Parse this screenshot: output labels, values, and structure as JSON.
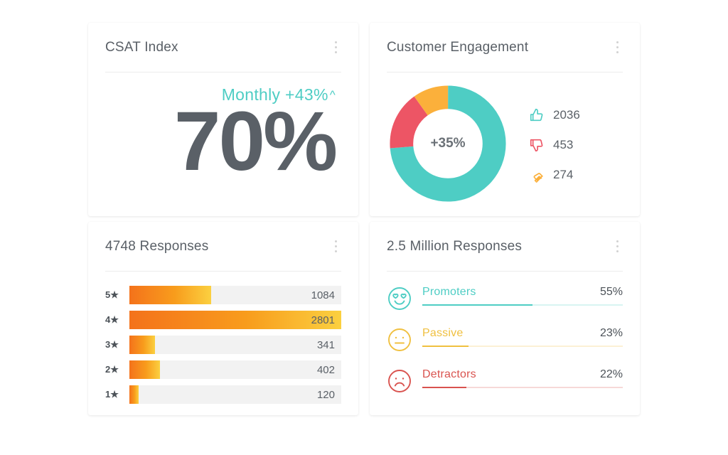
{
  "colors": {
    "teal": "#4ecdc4",
    "teal_dark": "#3fb8af",
    "red": "#ed5565",
    "yellow": "#fbb03b",
    "orange": "#f4721b",
    "orange_light": "#fbd040",
    "text_dark": "#5a6067",
    "track": "#f2f2f2",
    "card_bg": "#ffffff",
    "page_bg": "#ffffff"
  },
  "cards": {
    "csat": {
      "title": "CSAT Index",
      "menu_icon": "kebab-menu-icon",
      "subtitle": "Monthly +43%",
      "trend_caret": "^",
      "value": "70%"
    },
    "engagement": {
      "title": "Customer Engagement",
      "menu_icon": "kebab-menu-icon",
      "center_value": "+35%",
      "legend": [
        {
          "icon": "thumbs-up-icon",
          "value": "2036",
          "color": "#4ecdc4"
        },
        {
          "icon": "thumbs-down-icon",
          "value": "453",
          "color": "#ed5565"
        },
        {
          "icon": "thumbs-sideways-icon",
          "value": "274",
          "color": "#fbb03b"
        }
      ]
    },
    "responses": {
      "title": "4748 Responses",
      "menu_icon": "kebab-menu-icon"
    },
    "nps": {
      "title": "2.5 Million Responses",
      "menu_icon": "kebab-menu-icon",
      "rows": [
        {
          "icon": "heart-eyes-face-icon",
          "label": "Promoters",
          "percent": "55%",
          "pct_num": 55,
          "color": "#4ecdc4"
        },
        {
          "icon": "neutral-face-icon",
          "label": "Passive",
          "percent": "23%",
          "pct_num": 23,
          "color": "#f0c040"
        },
        {
          "icon": "frowning-face-icon",
          "label": "Detractors",
          "percent": "22%",
          "pct_num": 22,
          "color": "#d9534f"
        }
      ]
    }
  },
  "chart_data": [
    {
      "type": "pie",
      "title": "Customer Engagement",
      "center_label": "+35%",
      "donut": true,
      "labels": [
        "Positive",
        "Negative",
        "Neutral"
      ],
      "values": [
        2036,
        453,
        274
      ],
      "percent": [
        73.7,
        16.4,
        9.9
      ],
      "colors": [
        "#4ecdc4",
        "#ed5565",
        "#fbb03b"
      ],
      "legend_position": "right"
    },
    {
      "type": "bar",
      "title": "4748 Responses",
      "orientation": "horizontal",
      "categories": [
        "5★",
        "4★",
        "3★",
        "2★",
        "1★"
      ],
      "values": [
        1084,
        2801,
        341,
        402,
        120
      ],
      "bar_widths_pct": [
        38.7,
        100.0,
        12.2,
        14.4,
        4.3
      ],
      "xlabel": "",
      "ylabel": "",
      "grid": false,
      "colors": [
        "#f4721b",
        "#fbd040"
      ]
    },
    {
      "type": "bar",
      "title": "2.5 Million Responses",
      "orientation": "horizontal",
      "categories": [
        "Promoters",
        "Passive",
        "Detractors"
      ],
      "values": [
        55,
        23,
        22
      ],
      "value_labels": [
        "55%",
        "23%",
        "22%"
      ],
      "ylim": [
        0,
        100
      ],
      "grid": false,
      "colors": [
        "#4ecdc4",
        "#f0c040",
        "#d9534f"
      ]
    },
    {
      "type": "table",
      "title": "CSAT Index",
      "categories": [
        "Monthly change",
        "CSAT"
      ],
      "values": [
        "+43%",
        "70%"
      ]
    }
  ]
}
